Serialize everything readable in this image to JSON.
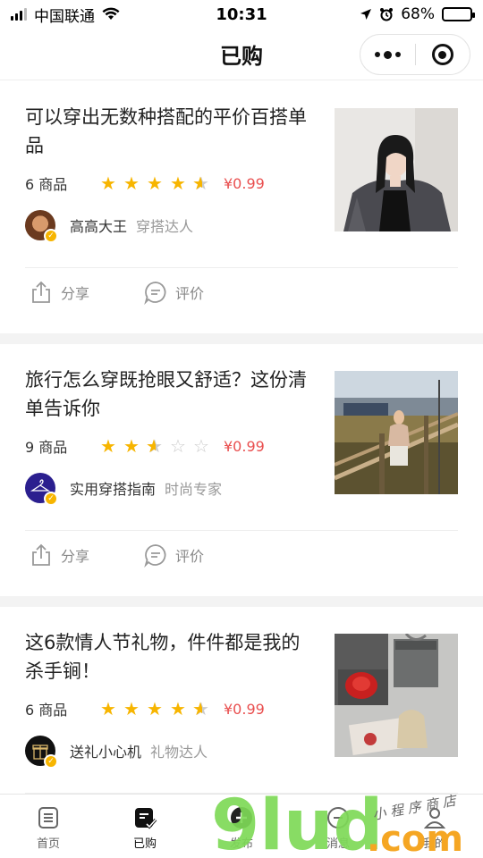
{
  "status_bar": {
    "carrier": "中国联通",
    "time": "10:31",
    "battery": "68%",
    "battery_level": 0.68
  },
  "navbar": {
    "title": "已购",
    "more_icon": "more-dots-icon",
    "close_icon": "target-icon"
  },
  "cards": [
    {
      "title": "可以穿出无数种搭配的平价百搭单品",
      "count": "6 商品",
      "rating": 4.5,
      "price": "¥0.99",
      "author": "高高大王",
      "tag": "穿搭达人",
      "share": "分享",
      "review": "评价"
    },
    {
      "title": "旅行怎么穿既抢眼又舒适？这份清单告诉你",
      "count": "9 商品",
      "rating": 2.5,
      "price": "¥0.99",
      "author": "实用穿搭指南",
      "tag": "时尚专家",
      "share": "分享",
      "review": "评价"
    },
    {
      "title": "这6款情人节礼物，件件都是我的杀手锏！",
      "count": "6 商品",
      "rating": 4.5,
      "price": "¥0.99",
      "author": "送礼小心机",
      "tag": "礼物达人",
      "share": "分享",
      "review": "评价"
    }
  ],
  "tabbar": {
    "items": [
      {
        "label": "首页",
        "icon": "list-icon"
      },
      {
        "label": "已购",
        "icon": "purchased-icon"
      },
      {
        "label": "发布",
        "icon": "publish-icon"
      },
      {
        "label": "消息",
        "icon": "message-icon"
      },
      {
        "label": "我的",
        "icon": "profile-icon"
      }
    ],
    "active": 1
  },
  "watermark": {
    "text": "9lud.com",
    "subtext": "小 程 序 商 店"
  },
  "colors": {
    "star": "#f7b500",
    "price": "#e94f4f",
    "watermark_green": "#7ed957",
    "watermark_orange": "#f5a623"
  }
}
